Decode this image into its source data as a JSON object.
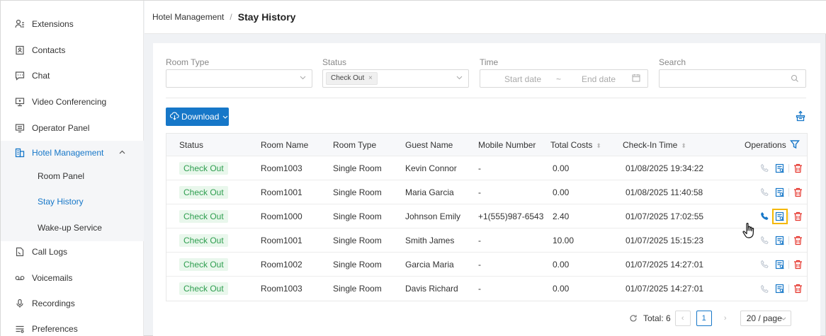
{
  "sidebar": {
    "items": [
      {
        "label": "Extensions",
        "icon": "extensions-icon"
      },
      {
        "label": "Contacts",
        "icon": "contacts-icon"
      },
      {
        "label": "Chat",
        "icon": "chat-icon"
      },
      {
        "label": "Video Conferencing",
        "icon": "video-icon"
      },
      {
        "label": "Operator Panel",
        "icon": "operator-panel-icon"
      },
      {
        "label": "Hotel Management",
        "icon": "hotel-icon"
      },
      {
        "label": "Room Panel"
      },
      {
        "label": "Stay History"
      },
      {
        "label": "Wake-up Service"
      },
      {
        "label": "Call Logs",
        "icon": "call-logs-icon"
      },
      {
        "label": "Voicemails",
        "icon": "voicemail-icon"
      },
      {
        "label": "Recordings",
        "icon": "recordings-icon"
      },
      {
        "label": "Preferences",
        "icon": "preferences-icon"
      }
    ]
  },
  "breadcrumb": {
    "root": "Hotel Management",
    "separator": "/",
    "current": "Stay History"
  },
  "filters": {
    "room_type_label": "Room Type",
    "status_label": "Status",
    "status_tag": "Check Out",
    "time_label": "Time",
    "start_ph": "Start date",
    "range_sep": "~",
    "end_ph": "End date",
    "search_label": "Search"
  },
  "toolbar": {
    "download_label": "Download"
  },
  "table": {
    "headers": {
      "status": "Status",
      "room_name": "Room Name",
      "room_type": "Room Type",
      "guest_name": "Guest Name",
      "mobile": "Mobile Number",
      "total_costs": "Total Costs",
      "check_in": "Check-In Time",
      "operations": "Operations"
    },
    "rows": [
      {
        "status": "Check Out",
        "room_name": "Room1003",
        "room_type": "Single Room",
        "guest_name": "Kevin Connor",
        "mobile": "-",
        "total_costs": "0.00",
        "check_in": "01/08/2025 19:34:22"
      },
      {
        "status": "Check Out",
        "room_name": "Room1001",
        "room_type": "Single Room",
        "guest_name": "Maria Garcia",
        "mobile": "-",
        "total_costs": "0.00",
        "check_in": "01/08/2025 11:40:58"
      },
      {
        "status": "Check Out",
        "room_name": "Room1000",
        "room_type": "Single Room",
        "guest_name": "Johnson Emily",
        "mobile": "+1(555)987-6543",
        "total_costs": "2.40",
        "check_in": "01/07/2025 17:02:55"
      },
      {
        "status": "Check Out",
        "room_name": "Room1001",
        "room_type": "Single Room",
        "guest_name": "Smith James",
        "mobile": "-",
        "total_costs": "10.00",
        "check_in": "01/07/2025 15:15:23"
      },
      {
        "status": "Check Out",
        "room_name": "Room1002",
        "room_type": "Single Room",
        "guest_name": "Garcia Maria",
        "mobile": "-",
        "total_costs": "0.00",
        "check_in": "01/07/2025 14:27:01"
      },
      {
        "status": "Check Out",
        "room_name": "Room1003",
        "room_type": "Single Room",
        "guest_name": "Davis Richard",
        "mobile": "-",
        "total_costs": "0.00",
        "check_in": "01/07/2025 14:27:01"
      }
    ]
  },
  "pagination": {
    "total_label": "Total: 6",
    "current_page": "1",
    "page_size": "20 / page"
  },
  "colors": {
    "accent": "#1677c8",
    "status_bg": "#e9f7ec",
    "status_text": "#2e9e4f",
    "delete": "#e5332a",
    "highlight": "#f5b800"
  }
}
